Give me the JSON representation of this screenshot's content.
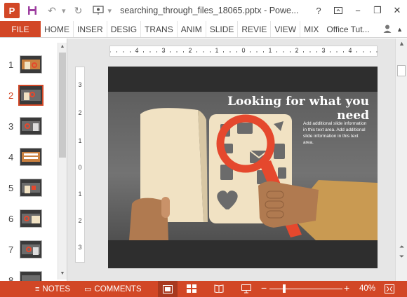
{
  "titlebar": {
    "app_icon": "P",
    "save_icon": "save-icon",
    "undo_icon": "undo-icon",
    "redo_icon": "redo-icon",
    "present_icon": "present-from-start-icon",
    "customize_icon": "customize-toolbar-icon",
    "doc_title": "searching_through_files_18065.pptx - Powe...",
    "help": "?",
    "ribbon_display": "ribbon-display-options-icon",
    "minimize": "−",
    "restore": "❐",
    "close": "✕"
  },
  "ribbon": {
    "file_label": "FILE",
    "tabs": [
      "HOME",
      "INSER",
      "DESIG",
      "TRANS",
      "ANIM",
      "SLIDE",
      "REVIE",
      "VIEW",
      "MIX"
    ],
    "user": "Office Tut...",
    "right_icons": [
      "user-icon",
      "collapse-ribbon-icon"
    ]
  },
  "thumbnails": {
    "items": [
      {
        "number": "1",
        "selected": false
      },
      {
        "number": "2",
        "selected": true
      },
      {
        "number": "3",
        "selected": false
      },
      {
        "number": "4",
        "selected": false
      },
      {
        "number": "5",
        "selected": false
      },
      {
        "number": "6",
        "selected": false
      },
      {
        "number": "7",
        "selected": false
      },
      {
        "number": "8",
        "selected": false
      }
    ]
  },
  "ruler": {
    "horizontal": [
      "4",
      "3",
      "2",
      "1",
      "0",
      "1",
      "2",
      "3",
      "4"
    ],
    "vertical": [
      "3",
      "2",
      "1",
      "0",
      "1",
      "2",
      "3"
    ]
  },
  "slide": {
    "title": "Looking for what you need",
    "body": "Add additional slide information in this text area. Add additional slide information in this text area."
  },
  "statusbar": {
    "notes_label": "NOTES",
    "comments_label": "COMMENTS",
    "view_icons": [
      "normal-view-icon",
      "slide-sorter-icon",
      "reading-view-icon",
      "slide-show-icon"
    ],
    "zoom_minus": "−",
    "zoom_plus": "+",
    "zoom_level": "40%",
    "zoom_fraction": 0.4,
    "fit_icon": "fit-slide-icon"
  },
  "colors": {
    "accent": "#d24726",
    "slide_bg": "#2e2e2e",
    "slide_mid": "#6a6a6a",
    "magnifier": "#e5482d",
    "paper": "#f1e2c3",
    "skin": "#b07a50",
    "sleeve": "#c99a52"
  }
}
